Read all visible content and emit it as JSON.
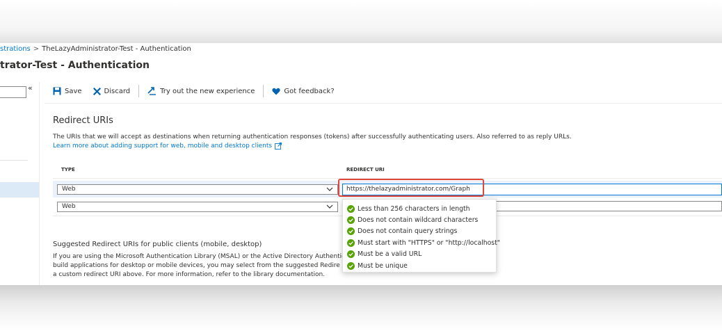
{
  "breadcrumb": {
    "link": "strations",
    "separator": ">",
    "current": "TheLazyAdministrator-Test - Authentication"
  },
  "page_title": "trator-Test - Authentication",
  "left_pane": {
    "collapse_icon": "«"
  },
  "toolbar": {
    "save_label": "Save",
    "discard_label": "Discard",
    "try_label": "Try out the new experience",
    "feedback_label": "Got feedback?"
  },
  "redirect": {
    "title": "Redirect URIs",
    "description": "The URIs that we will accept as destinations when returning authentication responses (tokens) after successfully authenticating users. Also referred to as reply URLs.",
    "learn_more": "Learn more about adding support for web, mobile and desktop clients",
    "col_type": "TYPE",
    "col_uri": "REDIRECT URI",
    "rows": [
      {
        "type": "Web",
        "uri": "https://thelazyadministrator.com/Graph"
      },
      {
        "type": "Web",
        "uri": ""
      }
    ]
  },
  "validation": [
    "Less than 256 characters in length",
    "Does not contain wildcard characters",
    "Does not contain query strings",
    "Must start with \"HTTPS\" or \"http://localhost\"",
    "Must be a valid URL",
    "Must be unique"
  ],
  "suggested": {
    "title": "Suggested Redirect URIs for public clients (mobile, desktop)",
    "line1": "If you are using the Microsoft Authentication Library (MSAL) or the Active Directory Authentic",
    "line2": "build applications for desktop or mobile devices, you may select from the suggested Redire",
    "line3": "a custom redirect URI above. For more information, refer to the library documentation."
  },
  "colors": {
    "accent": "#0078d4",
    "highlight": "#e0463c",
    "success": "#57a300",
    "heart": "#0063b1"
  }
}
